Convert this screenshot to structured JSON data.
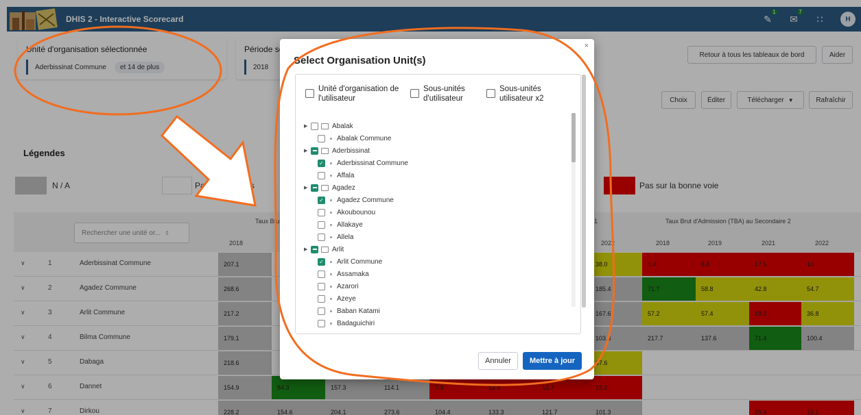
{
  "app": {
    "title": "DHIS 2 - Interactive Scorecard",
    "notifications_count": "1",
    "messages_count": "7",
    "user_initial": "H"
  },
  "header": {
    "org_unit_title": "Unité d'organisation sélectionnée",
    "org_unit_value": "Aderbissinat Commune",
    "org_unit_more": "et 14 de plus",
    "period_title": "Période se",
    "period_value": "2018",
    "back_button": "Retour à tous les tableaux de bord",
    "help_button": "Aider",
    "choice_button": "Choix",
    "edit_button": "Éditer",
    "download_button": "Télécharger",
    "refresh_button": "Rafraîchir"
  },
  "legend": {
    "title": "Légendes",
    "items": [
      {
        "label": "N / A",
        "color": "#c2c2c2"
      },
      {
        "label": "Pas de données",
        "color": "#ffffff"
      },
      {
        "label": "Pas sur la bonne voie",
        "color": "#e00000"
      }
    ]
  },
  "table": {
    "search_placeholder": "Rechercher une unité or...",
    "group_headers": [
      "Taux Bru",
      "1",
      "Taux Brut d'Admission (TBA) au Secondaire 2"
    ],
    "year_headers": [
      "2018",
      "2022",
      "2018",
      "2019",
      "2021",
      "2022"
    ],
    "rows": [
      {
        "num": "1",
        "name": "Aderbissinat Commune",
        "first": "207.1",
        "last": "38.0",
        "tba": [
          "1.4",
          "6.8",
          "17.5",
          "10"
        ]
      },
      {
        "num": "2",
        "name": "Agadez Commune",
        "first": "268.6",
        "last": "185.4",
        "tba": [
          "71.7",
          "58.8",
          "42.8",
          "54.7"
        ]
      },
      {
        "num": "3",
        "name": "Arlit Commune",
        "first": "217.2",
        "last": "167.6",
        "tba": [
          "57.2",
          "57.4",
          "19.3",
          "36.8"
        ]
      },
      {
        "num": "4",
        "name": "Bilma Commune",
        "first": "179.1",
        "last": "103.6",
        "tba": [
          "217.7",
          "137.6",
          "71.4",
          "100.4"
        ]
      },
      {
        "num": "5",
        "name": "Dabaga",
        "first": "218.6",
        "last": "37.6",
        "tba": [
          "",
          "",
          "",
          ""
        ]
      },
      {
        "num": "6",
        "name": "Dannet",
        "first": "154.9",
        "mid": [
          "84.3",
          "157.3",
          "114.1",
          "7.9",
          "12.8",
          "12.7"
        ],
        "last": "15.2",
        "tba": [
          "",
          "",
          "",
          ""
        ]
      },
      {
        "num": "7",
        "name": "Dirkou",
        "first": "228.2",
        "mid": [
          "154.6",
          "204.1",
          "273.6",
          "104.4",
          "133.3",
          "121.7"
        ],
        "last": "101.3",
        "tba": [
          "",
          "",
          "29.4",
          "33.1"
        ]
      }
    ]
  },
  "modal": {
    "title": "Select Organisation Unit(s)",
    "close": "×",
    "options": [
      "Unité d'organisation de l'utilisateur",
      "Sous-unités d'utilisateur",
      "Sous-unités utilisateur x2"
    ],
    "tree": [
      {
        "label": "Abalak",
        "type": "folder",
        "state": "none"
      },
      {
        "label": "Abalak Commune",
        "type": "leaf",
        "state": "none"
      },
      {
        "label": "Aderbissinat",
        "type": "folder",
        "state": "partial"
      },
      {
        "label": "Aderbissinat Commune",
        "type": "leaf",
        "state": "checked"
      },
      {
        "label": "Affala",
        "type": "leaf",
        "state": "none"
      },
      {
        "label": "Agadez",
        "type": "folder",
        "state": "partial"
      },
      {
        "label": "Agadez Commune",
        "type": "leaf",
        "state": "checked"
      },
      {
        "label": "Akoubounou",
        "type": "leaf",
        "state": "none"
      },
      {
        "label": "Allakaye",
        "type": "leaf",
        "state": "none"
      },
      {
        "label": "Allela",
        "type": "leaf",
        "state": "none"
      },
      {
        "label": "Arlit",
        "type": "folder",
        "state": "partial"
      },
      {
        "label": "Arlit Commune",
        "type": "leaf",
        "state": "checked"
      },
      {
        "label": "Assamaka",
        "type": "leaf",
        "state": "none"
      },
      {
        "label": "Azarori",
        "type": "leaf",
        "state": "none"
      },
      {
        "label": "Azeye",
        "type": "leaf",
        "state": "none"
      },
      {
        "label": "Baban Katami",
        "type": "leaf",
        "state": "none"
      },
      {
        "label": "Badaguichiri",
        "type": "leaf",
        "state": "none"
      }
    ],
    "cancel_button": "Annuler",
    "update_button": "Mettre à jour"
  },
  "colors": {
    "brand": "#2b5b84",
    "primary_button": "#1565c0",
    "checked": "#1e8c6e",
    "red": "#e00000",
    "green": "#1a8a1a",
    "yellow": "#d8d810",
    "grey": "#c2c2c2",
    "annotation": "#f26d1f"
  }
}
